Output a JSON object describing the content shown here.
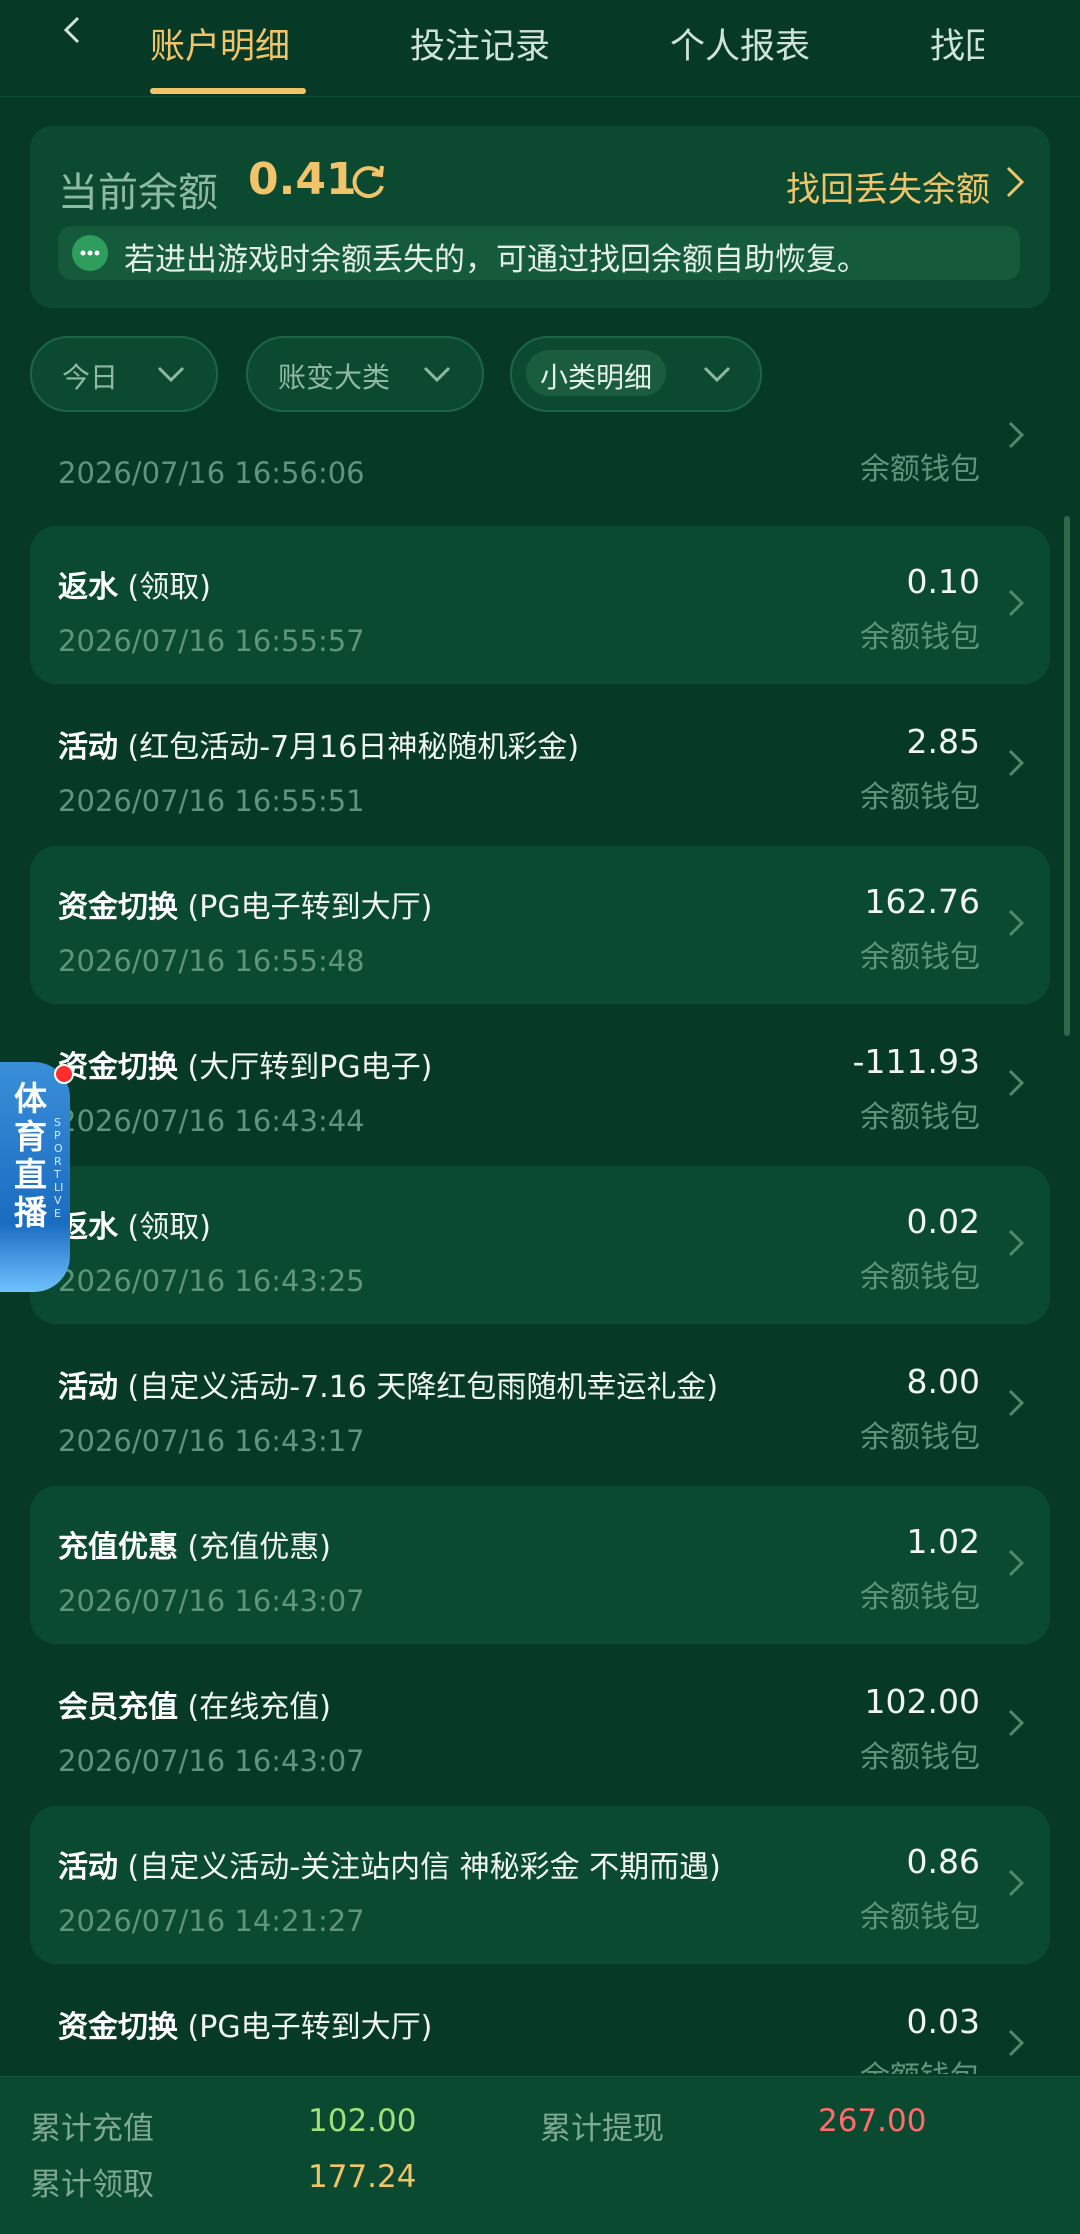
{
  "nav": {
    "tabs": [
      "账户明细",
      "投注记录",
      "个人报表",
      "找回"
    ],
    "active_index": 0
  },
  "balance": {
    "label": "当前余额",
    "value": "0.41",
    "recover_link": "找回丢失余额",
    "notice": "若进出游戏时余额丢失的，可通过找回余额自助恢复。"
  },
  "filters": [
    {
      "label": "今日"
    },
    {
      "label": "账变大类"
    },
    {
      "label": "小类明细"
    }
  ],
  "records": [
    {
      "type": "",
      "detail": "",
      "time": "2026/07/16 16:56:06",
      "amount": "",
      "wallet": "余额钱包"
    },
    {
      "type": "返水",
      "detail": "(领取)",
      "time": "2026/07/16 16:55:57",
      "amount": "0.10",
      "wallet": "余额钱包"
    },
    {
      "type": "活动",
      "detail": "(红包活动-7月16日神秘随机彩金)",
      "time": "2026/07/16 16:55:51",
      "amount": "2.85",
      "wallet": "余额钱包"
    },
    {
      "type": "资金切换",
      "detail": "(PG电子转到大厅)",
      "time": "2026/07/16 16:55:48",
      "amount": "162.76",
      "wallet": "余额钱包"
    },
    {
      "type": "资金切换",
      "detail": "(大厅转到PG电子)",
      "time": "2026/07/16 16:43:44",
      "amount": "-111.93",
      "wallet": "余额钱包"
    },
    {
      "type": "返水",
      "detail": "(领取)",
      "time": "2026/07/16 16:43:25",
      "amount": "0.02",
      "wallet": "余额钱包"
    },
    {
      "type": "活动",
      "detail": "(自定义活动-7.16 天降红包雨随机幸运礼金)",
      "time": "2026/07/16 16:43:17",
      "amount": "8.00",
      "wallet": "余额钱包"
    },
    {
      "type": "充值优惠",
      "detail": "(充值优惠)",
      "time": "2026/07/16 16:43:07",
      "amount": "1.02",
      "wallet": "余额钱包"
    },
    {
      "type": "会员充值",
      "detail": "(在线充值)",
      "time": "2026/07/16 16:43:07",
      "amount": "102.00",
      "wallet": "余额钱包"
    },
    {
      "type": "活动",
      "detail": "(自定义活动-关注站内信 神秘彩金 不期而遇)",
      "time": "2026/07/16 14:21:27",
      "amount": "0.86",
      "wallet": "余额钱包"
    },
    {
      "type": "资金切换",
      "detail": "(PG电子转到大厅)",
      "time": "",
      "amount": "0.03",
      "wallet": "余额钱包"
    }
  ],
  "live_widget": {
    "title": "体育直播",
    "subtitle": "SPORT LIVE"
  },
  "summary": {
    "deposit_label": "累计充值",
    "deposit_value": "102.00",
    "withdraw_label": "累计提现",
    "withdraw_value": "267.00",
    "claim_label": "累计领取",
    "claim_value": "177.24"
  },
  "colors": {
    "background": "#063a26",
    "card": "#0a4a30",
    "accent": "#f2c46a",
    "positive": "#9fe07a",
    "negative": "#ff6b6b"
  }
}
